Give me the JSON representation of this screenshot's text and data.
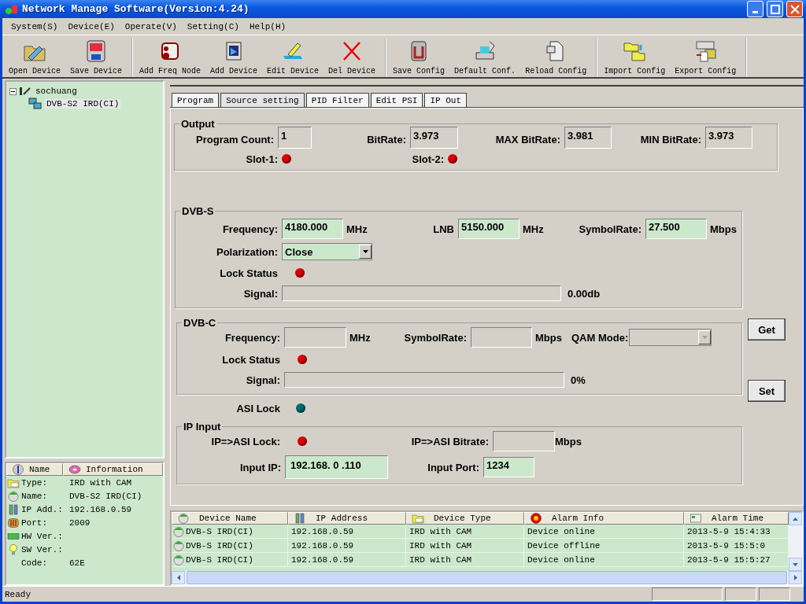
{
  "window": {
    "title": "Network Manage Software(Version:4.24)"
  },
  "menu": [
    "System(S)",
    "Device(E)",
    "Operate(V)",
    "Setting(C)",
    "Help(H)"
  ],
  "toolbar": [
    [
      {
        "label": "Open Device",
        "kind": "open"
      },
      {
        "label": "Save Device",
        "kind": "save"
      }
    ],
    [
      {
        "label": "Add Freq Node",
        "kind": "node"
      },
      {
        "label": "Add Device",
        "kind": "add"
      },
      {
        "label": "Edit Device",
        "kind": "edit"
      },
      {
        "label": "Del Device",
        "kind": "delete"
      }
    ],
    [
      {
        "label": "Save Config",
        "kind": "savecfg"
      },
      {
        "label": "Default Conf.",
        "kind": "default"
      },
      {
        "label": "Reload Config",
        "kind": "reload"
      }
    ],
    [
      {
        "label": "Import Config",
        "kind": "import"
      },
      {
        "label": "Export Config",
        "kind": "export"
      }
    ]
  ],
  "tree": [
    {
      "label": "sochuang",
      "expanded": true,
      "selected": false,
      "children": [
        {
          "label": "DVB-S2 IRD(CI)",
          "selected": true
        }
      ]
    }
  ],
  "info": {
    "columns": [
      "Name",
      "Information"
    ],
    "rows": [
      {
        "kind": "type",
        "name": "Type:",
        "value": "IRD with CAM"
      },
      {
        "kind": "name",
        "name": "Name:",
        "value": "DVB-S2 IRD(CI)"
      },
      {
        "kind": "ip",
        "name": "IP Add.:",
        "value": "192.168.0.59"
      },
      {
        "kind": "port",
        "name": "Port:",
        "value": "2009"
      },
      {
        "kind": "hw",
        "name": "HW Ver.:"
      },
      {
        "kind": "sw",
        "name": "SW Ver.:"
      },
      {
        "kind": "code",
        "name": "Code:",
        "value": "62E"
      }
    ]
  },
  "tabs": [
    {
      "label": "Program",
      "selected": false
    },
    {
      "label": "Source setting",
      "selected": true
    },
    {
      "label": "PID Filter",
      "selected": false
    },
    {
      "label": "Edit PSI",
      "selected": false
    },
    {
      "label": "IP Out",
      "selected": false
    }
  ],
  "output": {
    "title": "Output",
    "fields": [
      {
        "label": "Program Count:",
        "value": "1"
      },
      {
        "label": "BitRate:",
        "value": "3.973"
      },
      {
        "label": "MAX BitRate:",
        "value": "3.981"
      },
      {
        "label": "MIN BitRate:",
        "value": "3.973"
      }
    ],
    "slots": [
      {
        "label": "Slot-1:",
        "color": "#e00000"
      },
      {
        "label": "Slot-2:",
        "color": "#e00000"
      }
    ]
  },
  "dvb_s": {
    "title": "DVB-S",
    "fields": [
      {
        "label": "Frequency:",
        "value": "4180.000",
        "unit": "MHz"
      },
      {
        "label": "LNB",
        "value": "5150.000",
        "unit": "MHz"
      },
      {
        "label": "SymbolRate:",
        "value": "27.500",
        "unit": "Mbps"
      }
    ],
    "polarization": {
      "label": "Polarization:",
      "value": "Close"
    },
    "lock": {
      "label": "Lock Status",
      "color": "#e00000"
    },
    "signal": {
      "label": "Signal:",
      "level": 0,
      "reading": "0.00db"
    }
  },
  "dvb_c": {
    "title": "DVB-C",
    "fields": [
      {
        "label": "Frequency:",
        "unit": "MHz"
      },
      {
        "label": "SymbolRate:",
        "unit": "Mbps"
      }
    ],
    "qam": {
      "label": "QAM Mode:",
      "disabled": true
    },
    "lock": {
      "label": "Lock Status",
      "color": "#e00000"
    },
    "signal": {
      "label": "Signal:",
      "level": 0,
      "reading": "0%"
    }
  },
  "asi_lock": {
    "label": "ASI Lock",
    "color": "#006e6e"
  },
  "ip_input": {
    "title": "IP Input",
    "lock": {
      "label": "IP=>ASI Lock:",
      "color": "#e00000"
    },
    "bitrate": {
      "label": "IP=>ASI Bitrate:",
      "unit": "Mbps"
    },
    "input_ip": {
      "label": "Input IP:",
      "value": "192.168. 0 .110"
    },
    "input_port": {
      "label": "Input Port:",
      "value": "1234"
    }
  },
  "buttons": [
    "Get",
    "Set"
  ],
  "alarms": {
    "columns": [
      {
        "label": "Device Name",
        "kind": "device"
      },
      {
        "label": "IP Address",
        "kind": "ip"
      },
      {
        "label": "Device Type",
        "kind": "type"
      },
      {
        "label": "Alarm Info",
        "kind": "alarm"
      },
      {
        "label": "Alarm Time",
        "kind": "time"
      }
    ],
    "rows": [
      [
        "DVB-S IRD(CI)",
        "192.168.0.59",
        "IRD with CAM",
        "Device online",
        "2013-5-9 15:4:33"
      ],
      [
        "DVB-S IRD(CI)",
        "192.168.0.59",
        "IRD with CAM",
        "Device offline",
        "2013-5-9 15:5:0"
      ],
      [
        "DVB-S IRD(CI)",
        "192.168.0.59",
        "IRD with CAM",
        "Device online",
        "2013-5-9 15:5:27"
      ]
    ]
  },
  "status_bar": "Ready"
}
